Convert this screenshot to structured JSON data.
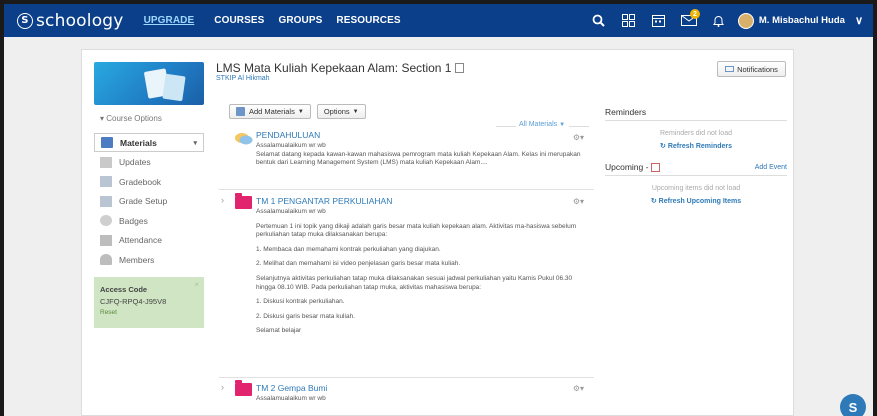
{
  "nav": {
    "logo": "schoology",
    "upgrade": "UPGRADE",
    "links": [
      "COURSES",
      "GROUPS",
      "RESOURCES"
    ],
    "message_badge": "2",
    "user_name": "M. Misbachul Huda"
  },
  "course": {
    "title": "LMS Mata Kuliah Kepekaan Alam: Section 1",
    "school": "STKIP Al Hikmah",
    "notifications_label": "Notifications",
    "options_label": "Course Options"
  },
  "sidebar": {
    "items": [
      {
        "label": "Materials",
        "icon": "materials-icon"
      },
      {
        "label": "Updates",
        "icon": "updates-icon"
      },
      {
        "label": "Gradebook",
        "icon": "gradebook-icon"
      },
      {
        "label": "Grade Setup",
        "icon": "grade-setup-icon"
      },
      {
        "label": "Badges",
        "icon": "badges-icon"
      },
      {
        "label": "Attendance",
        "icon": "attendance-icon"
      },
      {
        "label": "Members",
        "icon": "members-icon"
      }
    ],
    "access_code_title": "Access Code",
    "access_code": "CJFQ-RPQ4-J95V8",
    "access_reset": "Reset"
  },
  "toolbar": {
    "add_materials": "Add Materials",
    "options": "Options",
    "filter": "All Materials"
  },
  "materials": [
    {
      "title": "PENDAHULUAN",
      "lines": [
        "Assalamualaikum wr wb",
        "Selamat datang kepada kawan-kawan mahasiswa pemrogram mata kuliah Kepekaan Alam. Kelas ini merupakan bentuk dari Learning Management System (LMS) mata kuliah Kepekaan Alam...."
      ]
    },
    {
      "title": "TM 1 PENGANTAR PERKULIAHAN",
      "lines": [
        "Assalamualaikum wr wb",
        "Pertemuan 1 ini topik yang dikaji adalah garis besar mata kuliah kepekaan alam. Aktivitas ma-hasiswa sebelum perkuliahan tatap muka dilaksanakan berupa:",
        "1. Membaca dan memahami kontrak perkuliahan yang diajukan.",
        "2. Melihat dan memahami isi video penjelasan garis besar mata kuliah.",
        "Selanjutnya aktivitas perkuliahan tatap muka dilaksanakan sesuai jadwal perkuliahan yaitu Kamis Pukul 06.30 hingga 08.10 WIB. Pada perkuliahan tatap muka, aktivitas mahasiswa berupa:",
        "1. Diskusi kontrak perkuliahan.",
        "2. Diskusi garis besar mata kuliah.",
        "Selamat belajar"
      ]
    },
    {
      "title": "TM 2 Gempa Bumi",
      "lines": [
        "Assalamualaikum wr wb"
      ]
    }
  ],
  "reminders": {
    "title": "Reminders",
    "message": "Reminders did not load",
    "refresh": "Refresh Reminders"
  },
  "upcoming": {
    "title": "Upcoming -",
    "add_event": "Add Event",
    "message": "Upcoming items did not load",
    "refresh": "Refresh Upcoming Items"
  },
  "fab_label": "S"
}
